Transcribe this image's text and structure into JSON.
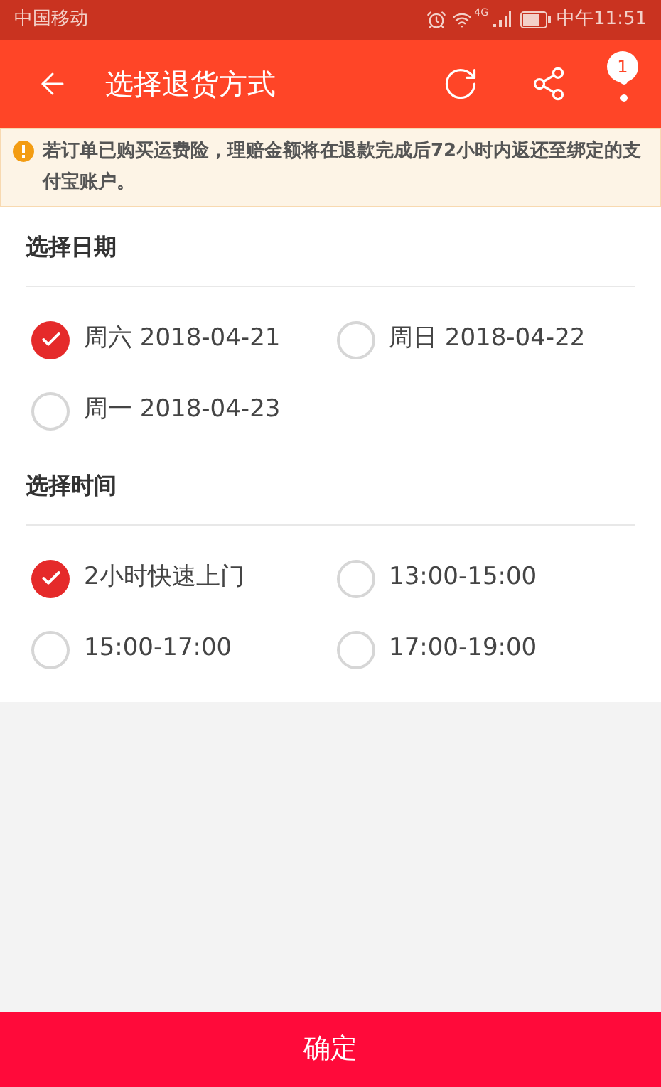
{
  "status_bar": {
    "carrier": "中国移动",
    "network": "4G",
    "time": "中午11:51"
  },
  "toolbar": {
    "title": "选择退货方式",
    "badge": "1"
  },
  "notice": {
    "text": "若订单已购买运费险，理赔金额将在退款完成后72小时内返还至绑定的支付宝账户。"
  },
  "sections": [
    {
      "title": "选择日期",
      "options": [
        {
          "label": "周六 2018-04-21",
          "selected": true
        },
        {
          "label": "周日 2018-04-22",
          "selected": false
        },
        {
          "label": "周一 2018-04-23",
          "selected": false
        }
      ]
    },
    {
      "title": "选择时间",
      "options": [
        {
          "label": "2小时快速上门",
          "selected": true
        },
        {
          "label": "13:00-15:00",
          "selected": false
        },
        {
          "label": "15:00-17:00",
          "selected": false
        },
        {
          "label": "17:00-19:00",
          "selected": false
        }
      ]
    }
  ],
  "confirm_button": "确定"
}
